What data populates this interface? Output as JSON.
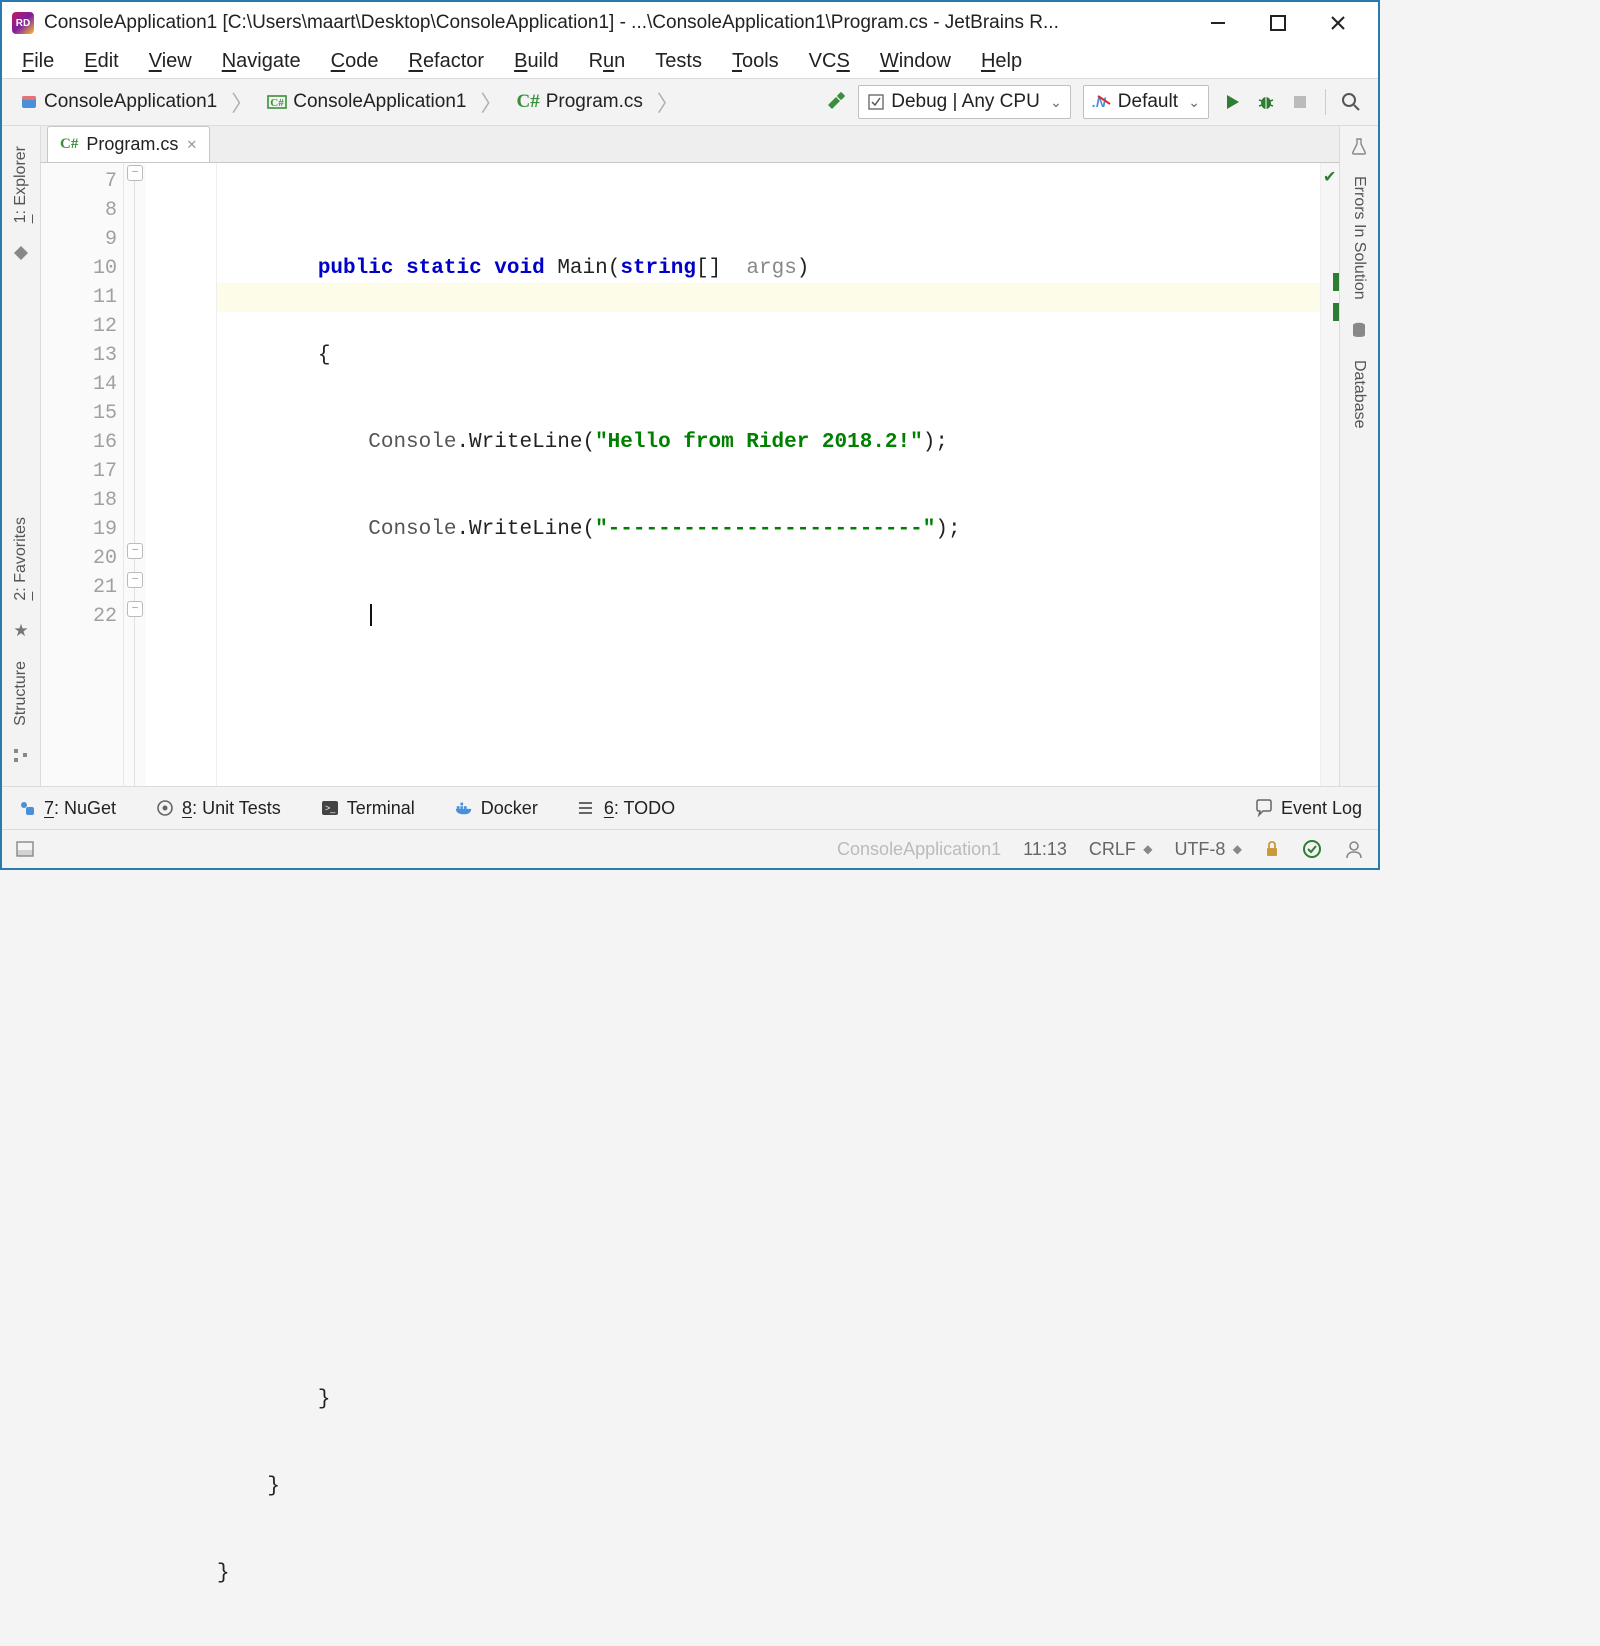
{
  "titlebar": {
    "title": "ConsoleApplication1 [C:\\Users\\maart\\Desktop\\ConsoleApplication1] - ...\\ConsoleApplication1\\Program.cs - JetBrains R..."
  },
  "menu": {
    "file": "File",
    "edit": "Edit",
    "view": "View",
    "navigate": "Navigate",
    "code": "Code",
    "refactor": "Refactor",
    "build": "Build",
    "run": "Run",
    "tests": "Tests",
    "tools": "Tools",
    "vcs": "VCS",
    "window": "Window",
    "help": "Help"
  },
  "breadcrumbs": {
    "root": "ConsoleApplication1",
    "project": "ConsoleApplication1",
    "file": "Program.cs"
  },
  "toolbar": {
    "config": "Debug | Any CPU",
    "target": "Default"
  },
  "tabs": {
    "file1_label": "Program.cs",
    "file1_prefix": "C#"
  },
  "left_rail": {
    "explorer": "1: Explorer",
    "favorites": "2: Favorites",
    "structure": "Structure"
  },
  "right_rail": {
    "errors": "Errors In Solution",
    "database": "Database"
  },
  "editor": {
    "line_numbers": [
      "7",
      "8",
      "9",
      "10",
      "11",
      "12",
      "13",
      "14",
      "15",
      "16",
      "17",
      "18",
      "19",
      "20",
      "21",
      "22"
    ],
    "code": {
      "l7_kw1": "public",
      "l7_kw2": "static",
      "l7_kw3": "void",
      "l7_name": " Main(",
      "l7_type": "string",
      "l7_br": "[] ",
      "l7_arg": " args",
      "l7_close": ")",
      "l8_brace": "{",
      "l9_a": "Console",
      "l9_b": ".WriteLine(",
      "l9_str": "\"Hello from Rider 2018.2!\"",
      "l9_c": ");",
      "l10_a": "Console",
      "l10_b": ".WriteLine(",
      "l10_str": "\"-------------------------\"",
      "l10_c": ");",
      "l20_brace": "}",
      "l21_brace": "}",
      "l22_brace": "}"
    }
  },
  "bottom": {
    "nuget": "7: NuGet",
    "unit_tests": "8: Unit Tests",
    "terminal": "Terminal",
    "docker": "Docker",
    "todo": "6: TODO",
    "event_log": "Event Log"
  },
  "status": {
    "project": "ConsoleApplication1",
    "caret": "11:13",
    "eol": "CRLF",
    "encoding": "UTF-8"
  }
}
